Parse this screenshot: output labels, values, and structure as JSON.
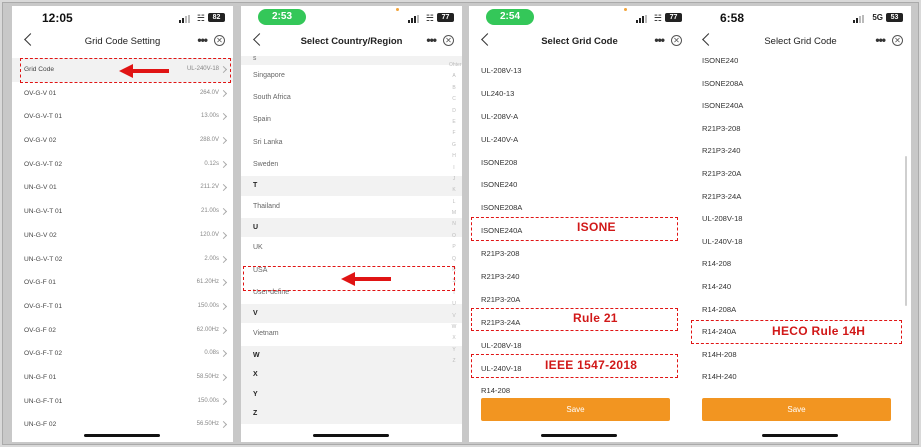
{
  "screen1": {
    "time": "12:05",
    "battery": "82",
    "title": "Grid Code Setting",
    "rows": [
      {
        "label": "Grid Code",
        "value": "UL-240V-18"
      },
      {
        "label": "OV-G-V 01",
        "value": "264.0V"
      },
      {
        "label": "OV-G-V-T 01",
        "value": "13.00s"
      },
      {
        "label": "OV-G-V 02",
        "value": "288.0V"
      },
      {
        "label": "OV-G-V-T 02",
        "value": "0.12s"
      },
      {
        "label": "UN-G-V 01",
        "value": "211.2V"
      },
      {
        "label": "UN-G-V-T 01",
        "value": "21.00s"
      },
      {
        "label": "UN-G-V 02",
        "value": "120.0V"
      },
      {
        "label": "UN-G-V-T 02",
        "value": "2.00s"
      },
      {
        "label": "OV-G-F 01",
        "value": "61.20Hz"
      },
      {
        "label": "OV-G-F-T 01",
        "value": "150.00s"
      },
      {
        "label": "OV-G-F 02",
        "value": "62.00Hz"
      },
      {
        "label": "OV-G-F-T 02",
        "value": "0.08s"
      },
      {
        "label": "UN-G-F 01",
        "value": "58.50Hz"
      },
      {
        "label": "UN-G-F-T 01",
        "value": "150.00s"
      },
      {
        "label": "UN-G-F 02",
        "value": "56.50Hz"
      }
    ]
  },
  "screen2": {
    "time": "2:53",
    "battery": "77",
    "title": "Select Country/Region",
    "top_header": "S",
    "rows": [
      {
        "label": "Singapore",
        "header": false
      },
      {
        "label": "South Africa",
        "header": false
      },
      {
        "label": "Spain",
        "header": false
      },
      {
        "label": "Sri Lanka",
        "header": false
      },
      {
        "label": "Sweden",
        "header": false
      },
      {
        "label": "T",
        "header": true
      },
      {
        "label": "Thailand",
        "header": false
      },
      {
        "label": "U",
        "header": true
      },
      {
        "label": "UK",
        "header": false
      },
      {
        "label": "USA",
        "header": false
      },
      {
        "label": "User-define",
        "header": false
      },
      {
        "label": "V",
        "header": true
      },
      {
        "label": "Vietnam",
        "header": false
      },
      {
        "label": "W",
        "header": true
      },
      {
        "label": "X",
        "header": true
      },
      {
        "label": "Y",
        "header": true
      },
      {
        "label": "Z",
        "header": true
      }
    ],
    "index_letters": [
      "Ohter",
      "A",
      "B",
      "C",
      "D",
      "E",
      "F",
      "G",
      "H",
      "I",
      "J",
      "K",
      "L",
      "M",
      "N",
      "O",
      "P",
      "Q",
      "R",
      "S",
      "T",
      "U",
      "V",
      "W",
      "X",
      "Y",
      "Z"
    ]
  },
  "screen3": {
    "time": "2:54",
    "battery": "77",
    "title": "Select Grid Code",
    "rows": [
      "UL-208V-13",
      "UL240-13",
      "UL-208V-A",
      "UL-240V-A",
      "ISONE208",
      "ISONE240",
      "ISONE208A",
      "ISONE240A",
      "R21P3-208",
      "R21P3-240",
      "R21P3-20A",
      "R21P3-24A",
      "UL-208V-18",
      "UL-240V-18",
      "R14-208"
    ],
    "save_label": "Save",
    "annotations": {
      "isone": "ISONE",
      "rule21": "Rule 21",
      "ieee": "IEEE 1547-2018"
    }
  },
  "screen4": {
    "time": "6:58",
    "network": "5G",
    "battery": "53",
    "title": "Select Grid Code",
    "rows": [
      "ISONE240",
      "ISONE208A",
      "ISONE240A",
      "R21P3-208",
      "R21P3-240",
      "R21P3-20A",
      "R21P3-24A",
      "UL-208V-18",
      "UL-240V-18",
      "R14-208",
      "R14-240",
      "R14-208A",
      "R14-240A",
      "R14H-208",
      "R14H-240"
    ],
    "save_label": "Save",
    "annotations": {
      "heco": "HECO Rule 14H"
    }
  },
  "colors": {
    "accent": "#f29521",
    "annotation": "#e01414",
    "status_green": "#34c759"
  },
  "icons": {
    "back": "chevron-left-icon",
    "more": "more-dots-icon",
    "close": "close-circle-icon",
    "arrow": "red-arrow-icon"
  }
}
